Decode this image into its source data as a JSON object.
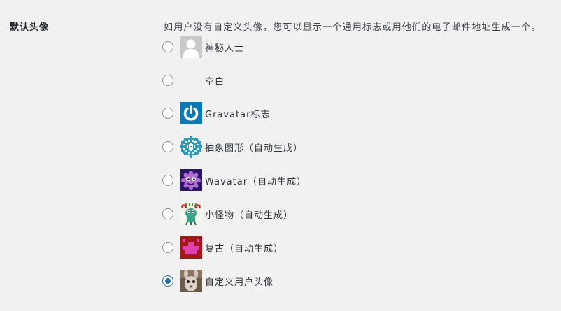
{
  "setting": {
    "label": "默认头像",
    "description": "如用户没有自定义头像，您可以显示一个通用标志或用他们的电子邮件地址生成一个。"
  },
  "options": [
    {
      "label": "神秘人士",
      "icon": "mystery-person-avatar",
      "checked": false
    },
    {
      "label": "空白",
      "icon": "blank-avatar",
      "checked": false
    },
    {
      "label": "Gravatar标志",
      "icon": "gravatar-logo-avatar",
      "checked": false
    },
    {
      "label": "抽象图形（自动生成）",
      "icon": "identicon-avatar",
      "checked": false
    },
    {
      "label": "Wavatar（自动生成）",
      "icon": "wavatar-avatar",
      "checked": false
    },
    {
      "label": "小怪物（自动生成）",
      "icon": "monsterid-avatar",
      "checked": false
    },
    {
      "label": "复古（自动生成）",
      "icon": "retro-avatar",
      "checked": false
    },
    {
      "label": "自定义用户头像",
      "icon": "custom-avatar",
      "checked": true
    }
  ],
  "colors": {
    "accent": "#2271b1",
    "gravatar_blue": "#0a78b5"
  }
}
